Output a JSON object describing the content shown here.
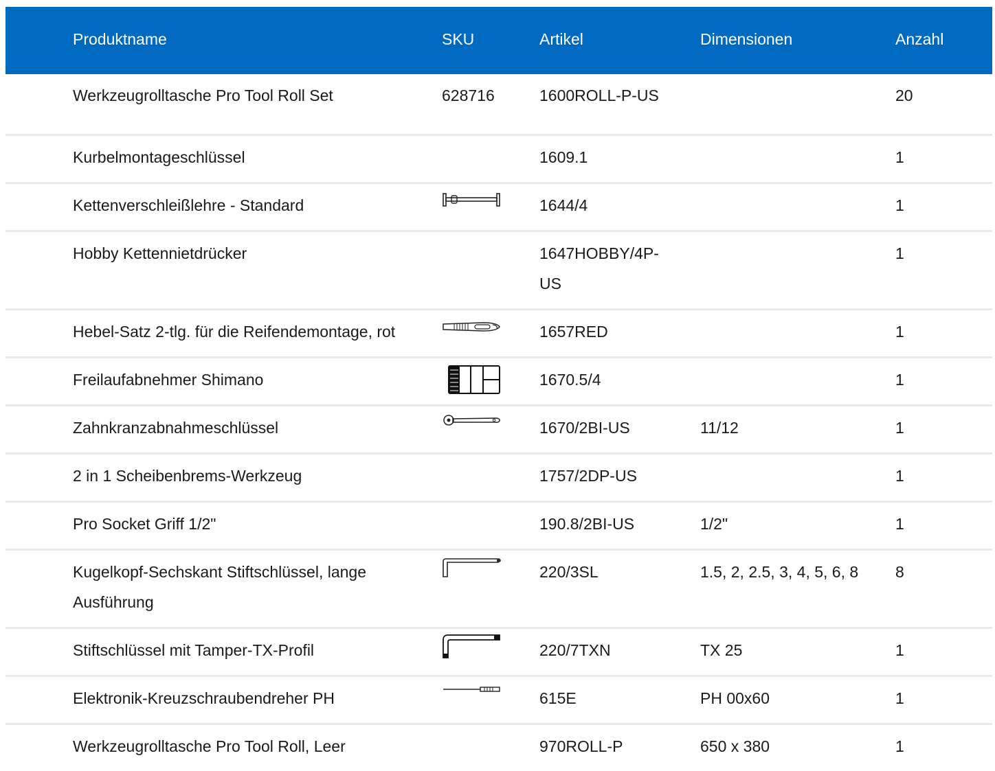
{
  "table": {
    "headers": {
      "name": "Produktname",
      "sku": "SKU",
      "article": "Artikel",
      "dimensions": "Dimensionen",
      "quantity": "Anzahl"
    },
    "rows": [
      {
        "name": "Werkzeugrolltasche Pro Tool Roll Set",
        "sku": "628716",
        "article": "1600ROLL-P-US",
        "dimensions": "",
        "quantity": "20"
      },
      {
        "name": "Kurbelmontageschlüssel",
        "sku": "",
        "article": "1609.1",
        "dimensions": "",
        "quantity": "1"
      },
      {
        "name": "Kettenverschleißlehre - Standard",
        "sku": "",
        "article": "1644/4",
        "dimensions": "",
        "quantity": "1",
        "icon": "chain-checker-icon"
      },
      {
        "name": "Hobby Kettennietdrücker",
        "sku": "",
        "article": "1647HOBBY/4P-US",
        "dimensions": "",
        "quantity": "1"
      },
      {
        "name": "Hebel-Satz 2-tlg. für die Reifendemontage, rot",
        "sku": "",
        "article": "1657RED",
        "dimensions": "",
        "quantity": "1",
        "icon": "tire-lever-icon"
      },
      {
        "name": "Freilaufabnehmer Shimano",
        "sku": "",
        "article": "1670.5/4",
        "dimensions": "",
        "quantity": "1",
        "icon": "freewheel-remover-icon"
      },
      {
        "name": "Zahnkranzabnahmeschlüssel",
        "sku": "",
        "article": "1670/2BI-US",
        "dimensions": "11/12",
        "quantity": "1",
        "icon": "ratchet-wrench-icon"
      },
      {
        "name": "2 in 1 Scheibenbrems-Werkzeug",
        "sku": "",
        "article": "1757/2DP-US",
        "dimensions": "",
        "quantity": "1"
      },
      {
        "name": "Pro Socket Griff 1/2\"",
        "sku": "",
        "article": "190.8/2BI-US",
        "dimensions": "1/2\"",
        "quantity": "1"
      },
      {
        "name": "Kugelkopf-Sechskant Stiftschlüssel, lange Ausführung",
        "sku": "",
        "article": "220/3SL",
        "dimensions": "1.5, 2, 2.5, 3, 4, 5, 6, 8",
        "quantity": "8",
        "icon": "hex-key-icon"
      },
      {
        "name": "Stiftschlüssel mit Tamper-TX-Profil",
        "sku": "",
        "article": "220/7TXN",
        "dimensions": "TX 25",
        "quantity": "1",
        "icon": "torx-key-icon"
      },
      {
        "name": "Elektronik-Kreuzschraubendreher PH",
        "sku": "",
        "article": "615E",
        "dimensions": "PH 00x60",
        "quantity": "1",
        "icon": "screwdriver-icon"
      },
      {
        "name": "Werkzeugrolltasche Pro Tool Roll, Leer",
        "sku": "",
        "article": "970ROLL-P",
        "dimensions": "650 x 380",
        "quantity": "1"
      }
    ]
  },
  "colors": {
    "header_bg": "#0069c0",
    "header_text": "#ffffff",
    "row_divider": "#e9e9e9"
  }
}
